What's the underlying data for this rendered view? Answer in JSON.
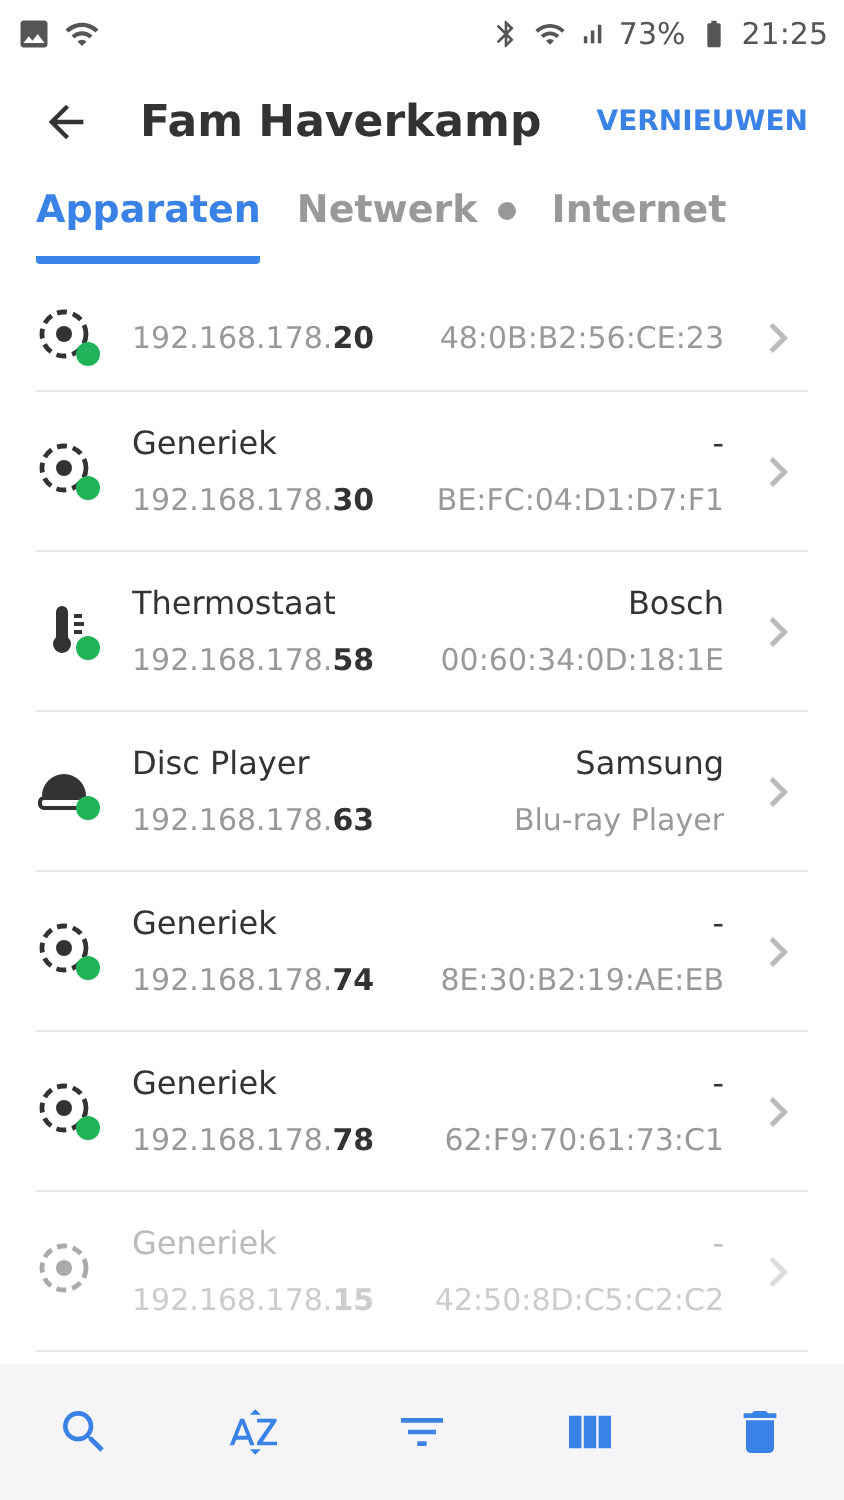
{
  "status_bar": {
    "battery": "73%",
    "time": "21:25"
  },
  "header": {
    "title": "Fam Haverkamp",
    "action": "VERNIEUWEN"
  },
  "tabs": [
    {
      "label": "Apparaten",
      "selected": true,
      "dot": false
    },
    {
      "label": "Netwerk",
      "selected": false,
      "dot": true
    },
    {
      "label": "Internet",
      "selected": false,
      "dot": false
    }
  ],
  "devices": [
    {
      "kind": "generic",
      "online": true,
      "ip": "192.168.178.**20**",
      "mac": "48:0B:B2:56:CE:23"
    },
    {
      "kind": "generic",
      "online": true,
      "name": "Generiek",
      "vendor": "-",
      "ip": "192.168.178.**30**",
      "mac": "BE:FC:04:D1:D7:F1"
    },
    {
      "kind": "thermostat",
      "online": true,
      "name": "Thermostaat",
      "vendor": "Bosch",
      "ip": "192.168.178.**58**",
      "mac": "00:60:34:0D:18:1E"
    },
    {
      "kind": "disc",
      "online": true,
      "name": "Disc Player",
      "vendor": "Samsung",
      "ip": "192.168.178.**63**",
      "mac": "Blu-ray Player"
    },
    {
      "kind": "generic",
      "online": true,
      "name": "Generiek",
      "vendor": "-",
      "ip": "192.168.178.**74**",
      "mac": "8E:30:B2:19:AE:EB"
    },
    {
      "kind": "generic",
      "online": true,
      "name": "Generiek",
      "vendor": "-",
      "ip": "192.168.178.**78**",
      "mac": "62:F9:70:61:73:C1"
    },
    {
      "kind": "generic",
      "online": false,
      "name": "Generiek",
      "vendor": "-",
      "ip": "192.168.178.**15**",
      "mac": "42:50:8D:C5:C2:C2"
    }
  ],
  "toolbar": [
    {
      "kind": "search"
    },
    {
      "kind": "sort"
    },
    {
      "kind": "filter"
    },
    {
      "kind": "columns"
    },
    {
      "kind": "delete"
    }
  ]
}
